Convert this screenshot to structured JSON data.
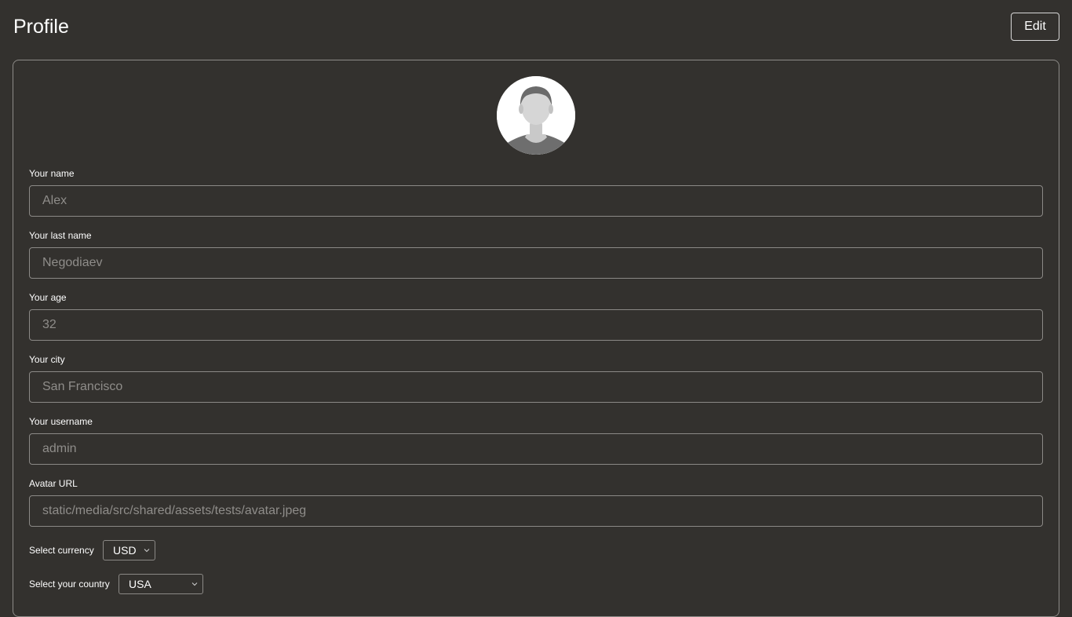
{
  "header": {
    "title": "Profile",
    "edit_label": "Edit"
  },
  "profile": {
    "avatar_icon": "user-avatar-icon",
    "fields": [
      {
        "label": "Your name",
        "value": "Alex"
      },
      {
        "label": "Your last name",
        "value": "Negodiaev"
      },
      {
        "label": "Your age",
        "value": "32"
      },
      {
        "label": "Your city",
        "value": "San Francisco"
      },
      {
        "label": "Your username",
        "value": "admin"
      },
      {
        "label": "Avatar URL",
        "value": "static/media/src/shared/assets/tests/avatar.jpeg"
      }
    ],
    "currency": {
      "label": "Select currency",
      "selected": "USD"
    },
    "country": {
      "label": "Select your country",
      "selected": "USA"
    }
  },
  "colors": {
    "background": "#33312e",
    "border": "#8b8986",
    "input_text": "#8f8d8a"
  }
}
